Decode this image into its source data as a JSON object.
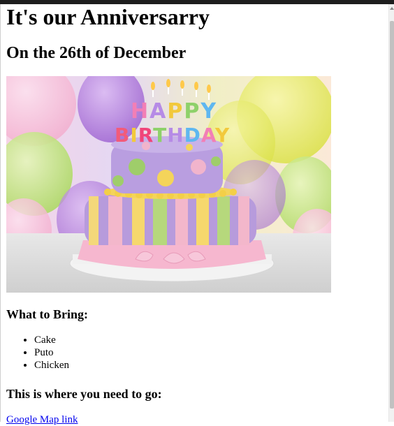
{
  "page": {
    "title": "It's our Anniversarry",
    "date_heading": "On the 26th of December",
    "bring_heading": "What to Bring:",
    "bring_items": [
      "Cake",
      "Puto",
      "Chicken"
    ],
    "where_heading": "This is where you need to go:",
    "map_link_text": "Google Map link"
  },
  "image": {
    "candle_text": "HAPPY BIRTHDAY"
  }
}
